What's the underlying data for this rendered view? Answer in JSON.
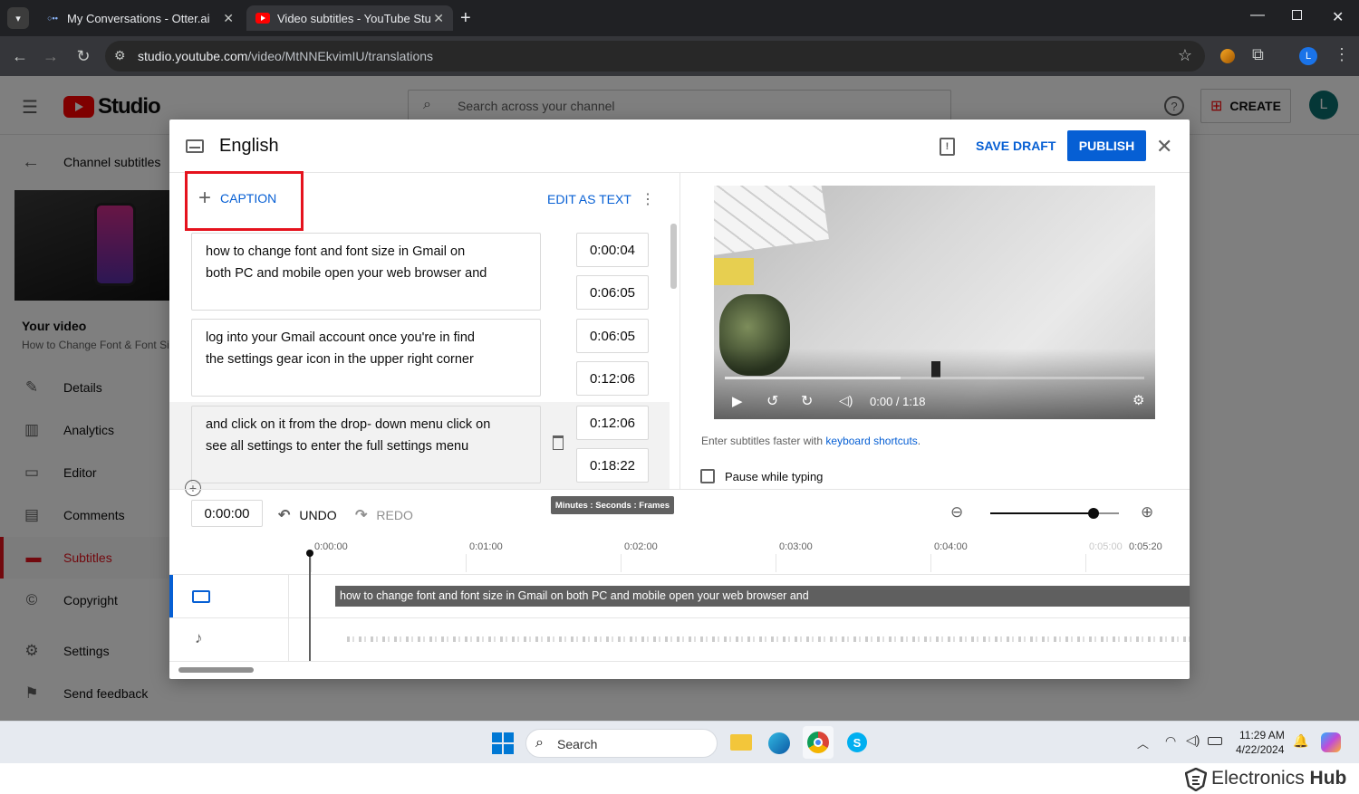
{
  "browser": {
    "tabs": [
      {
        "title": "My Conversations - Otter.ai",
        "favicon": "otter"
      },
      {
        "title": "Video subtitles - YouTube Studi",
        "favicon": "youtube"
      }
    ],
    "url_host": "studio.youtube.com",
    "url_path": "/video/MtNNEkvimIU/translations",
    "profile_letter": "L"
  },
  "studio": {
    "logo_text": "Studio",
    "search_placeholder": "Search across your channel",
    "create_label": "CREATE",
    "avatar_letter": "L",
    "back_label": "Channel subtitles",
    "your_video_label": "Your video",
    "video_title": "How to Change Font & Font Si",
    "sidebar": [
      {
        "label": "Details",
        "icon": "pencil-icon",
        "glyph": "✎"
      },
      {
        "label": "Analytics",
        "icon": "analytics-icon",
        "glyph": "▥"
      },
      {
        "label": "Editor",
        "icon": "editor-icon",
        "glyph": "▭"
      },
      {
        "label": "Comments",
        "icon": "comments-icon",
        "glyph": "▤"
      },
      {
        "label": "Subtitles",
        "icon": "subtitles-icon",
        "glyph": "▬",
        "active": true
      },
      {
        "label": "Copyright",
        "icon": "copyright-icon",
        "glyph": "©"
      },
      {
        "label": "Settings",
        "icon": "gear-icon",
        "glyph": "⚙"
      },
      {
        "label": "Send feedback",
        "icon": "feedback-icon",
        "glyph": "⚑"
      }
    ]
  },
  "dialog": {
    "title": "English",
    "save_draft": "SAVE DRAFT",
    "publish": "PUBLISH",
    "add_caption": "CAPTION",
    "edit_as_text": "EDIT AS TEXT",
    "captions": [
      {
        "line1": "how to change font and font size in Gmail on",
        "line2": "both PC and mobile open your web browser and",
        "start": "0:00:04",
        "end": "0:06:05"
      },
      {
        "line1": "log into your Gmail account once you're in find",
        "line2": "the settings gear icon in the upper right corner",
        "start": "0:06:05",
        "end": "0:12:06"
      },
      {
        "line1": "and click on it from the drop- down menu click on",
        "line2": "see all settings to enter the full settings menu",
        "start": "0:12:06",
        "end": "0:18:22"
      }
    ],
    "player_time": "0:00 / 1:18",
    "player_progress": 0.0,
    "hint_prefix": "Enter subtitles faster with ",
    "hint_link": "keyboard shortcuts",
    "hint_suffix": ".",
    "pause_label": "Pause while typing",
    "current_time": "0:00:00",
    "undo": "UNDO",
    "redo": "REDO",
    "tooltip": "Minutes : Seconds : Frames",
    "zoom_level": 0.8,
    "timeline_ticks": [
      "0:00:00",
      "0:01:00",
      "0:02:00",
      "0:03:00",
      "0:04:00",
      "0:05:00",
      "0:05:20"
    ],
    "timeline_caption": "how to change font and font size in Gmail on  both PC and mobile open your web browser and"
  },
  "taskbar": {
    "search_label": "Search",
    "time": "11:29 AM",
    "date": "4/22/2024"
  },
  "watermark": {
    "brand_light": "Electronics",
    "brand_bold": "Hub"
  },
  "colors": {
    "accent_blue": "#065fd4",
    "highlight_red": "#e5121d",
    "youtube_red": "#ff0000"
  }
}
